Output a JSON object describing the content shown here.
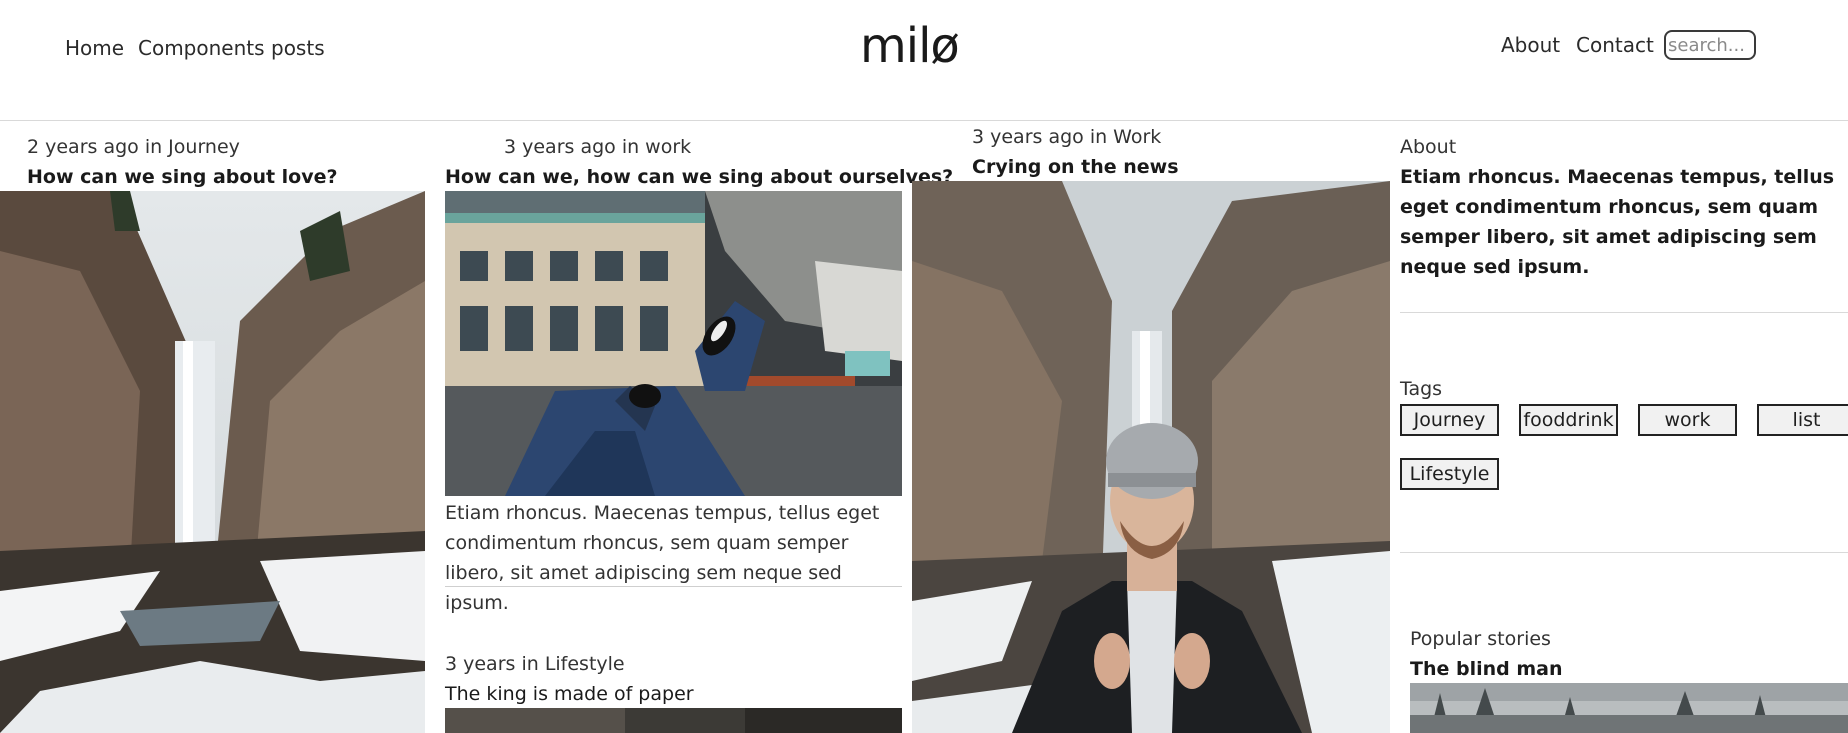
{
  "header": {
    "logo": "milø",
    "nav_left": [
      "Home",
      "Components",
      "posts"
    ],
    "nav_right": [
      "About",
      "Contact"
    ],
    "search_placeholder": "search..."
  },
  "posts": [
    {
      "meta": "2 years ago in Journey",
      "title": "How can we sing about love?",
      "image": "waterfall-canyon"
    },
    {
      "meta": "3 years ago in work",
      "title": "How can we, how can we sing about ourselves?",
      "image": "legs-over-rooftop",
      "excerpt": "Etiam rhoncus. Maecenas tempus, tellus eget condimentum rhoncus, sem quam semper libero, sit amet adipiscing sem neque sed ipsum."
    },
    {
      "meta": "3 years ago in Work",
      "title": "Crying on the news",
      "image": "man-in-beanie-at-waterfall"
    },
    {
      "meta": "3 years in Lifestyle",
      "title": "The king is made of paper",
      "image": "dark-photo"
    }
  ],
  "sidebar": {
    "about_heading": "About",
    "about_text": "Etiam rhoncus. Maecenas tempus, tellus eget condimentum rhoncus, sem quam semper libero, sit amet adipiscing sem neque sed ipsum.",
    "tags_heading": "Tags",
    "tags": [
      "Journey",
      "fooddrink",
      "work",
      "list",
      "Lifestyle"
    ],
    "popular_heading": "Popular stories",
    "popular_title": "The blind man"
  }
}
